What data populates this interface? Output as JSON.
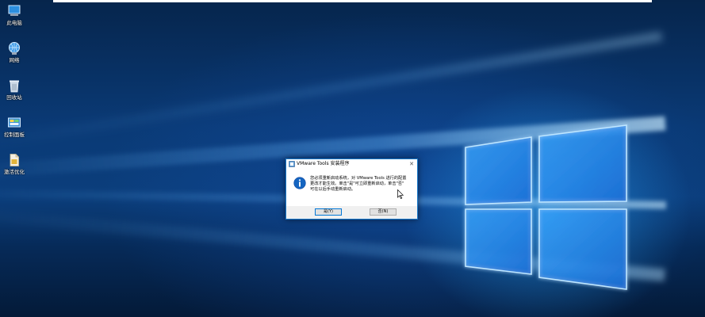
{
  "desktop_icons": [
    {
      "label": "此电脑",
      "icon": "this-pc-icon"
    },
    {
      "label": "网络",
      "icon": "network-icon"
    },
    {
      "label": "回收站",
      "icon": "recycle-bin-icon"
    },
    {
      "label": "控制面板",
      "icon": "control-panel-icon"
    },
    {
      "label": "激活优化",
      "icon": "file-icon"
    }
  ],
  "dialog": {
    "title": "VMware Tools 安装程序",
    "close_glyph": "✕",
    "message_lines": [
      "您必须重新启动系统，对 VMware Tools 进行的配置",
      "更改才能生效。单击\"是\"可立即重新启动，单击\"否\"",
      "可在以后手动重新启动。"
    ],
    "yes_label": "是(Y)",
    "no_label": "否(N)"
  },
  "colors": {
    "desktop_bg": "#0b3e7c",
    "logo_glow": "#4fb8ff",
    "dialog_border": "#1979ca",
    "info_icon": "#1565c0"
  }
}
